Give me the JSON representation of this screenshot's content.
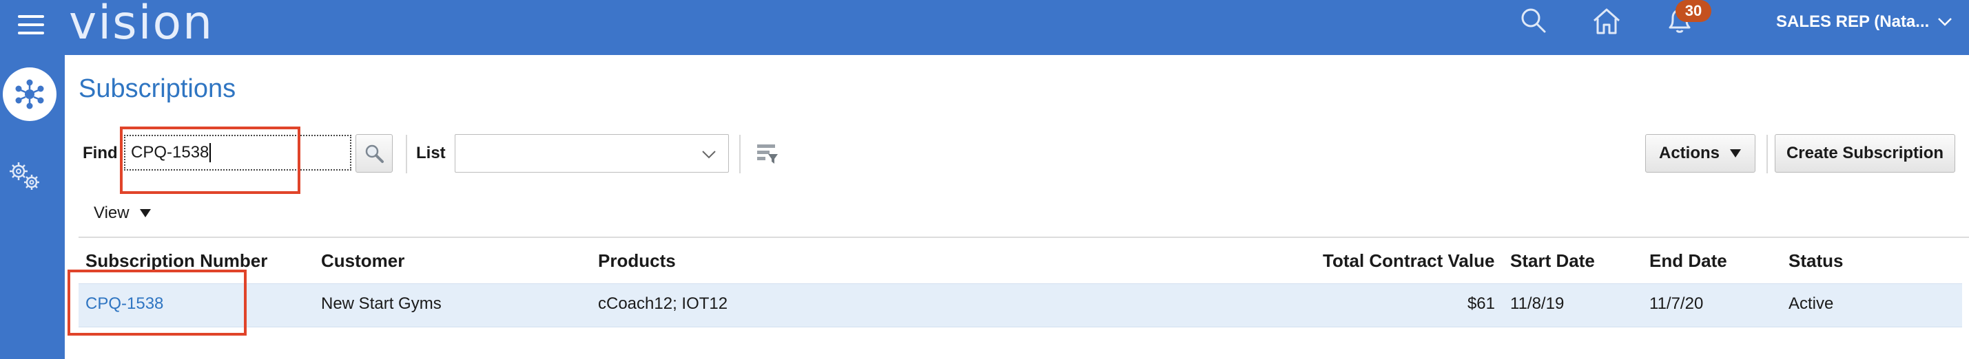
{
  "header": {
    "brand": "vision",
    "notification_count": "30",
    "user_label": "SALES REP (Nata..."
  },
  "page": {
    "title": "Subscriptions"
  },
  "search": {
    "find_label": "Find",
    "find_value": "CPQ-1538",
    "list_label": "List",
    "list_value": ""
  },
  "toolbar": {
    "actions_label": "Actions",
    "create_label": "Create Subscription",
    "view_label": "View"
  },
  "table": {
    "columns": {
      "subscription_number": "Subscription Number",
      "customer": "Customer",
      "products": "Products",
      "total_contract_value": "Total Contract Value",
      "start_date": "Start Date",
      "end_date": "End Date",
      "status": "Status"
    },
    "rows": [
      {
        "subscription_number": "CPQ-1538",
        "customer": "New Start Gyms",
        "products": "cCoach12; IOT12",
        "total_contract_value": "$61",
        "start_date": "11/8/19",
        "end_date": "11/7/20",
        "status": "Active"
      }
    ]
  },
  "colors": {
    "header_bg": "#3d75c9",
    "link": "#2f75c2",
    "badge": "#c4511f",
    "annotation": "#e0442a",
    "selected_row": "#e4eef9"
  },
  "icons": [
    "menu-icon",
    "search-icon",
    "home-icon",
    "notifications-icon",
    "chevron-down-icon",
    "subscriptions-hub-icon",
    "settings-gears-icon",
    "magnifier-icon",
    "column-filter-icon",
    "caret-down-icon"
  ]
}
